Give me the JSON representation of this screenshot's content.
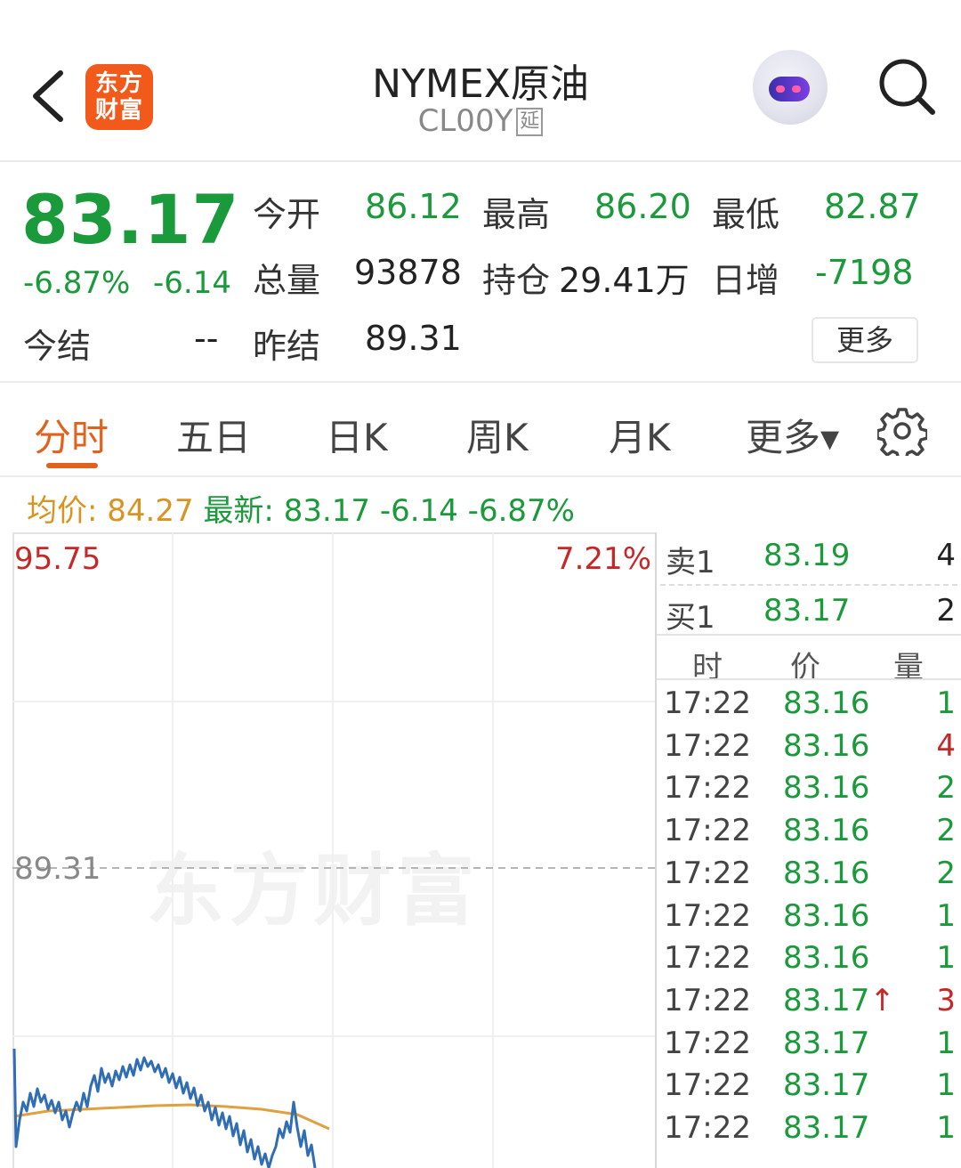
{
  "header": {
    "logo_line1": "东方",
    "logo_line2": "财富",
    "title": "NYMEX原油",
    "code": "CL00Y",
    "delay_tag": "延"
  },
  "quote": {
    "price": "83.17",
    "change_pct": "-6.87%",
    "change_abs": "-6.14",
    "open_label": "今开",
    "open": "86.12",
    "high_label": "最高",
    "high": "86.20",
    "low_label": "最低",
    "low": "82.87",
    "volume_label": "总量",
    "volume": "93878",
    "oi_label": "持仓",
    "oi": "29.41万",
    "daily_inc_label": "日增",
    "daily_inc": "-7198",
    "settle_label": "今结",
    "settle": "--",
    "prev_settle_label": "昨结",
    "prev_settle": "89.31",
    "more_label": "更多"
  },
  "tabs": [
    "分时",
    "五日",
    "日K",
    "周K",
    "月K",
    "更多▾"
  ],
  "info": {
    "avg_label": "均价:",
    "avg": "84.27",
    "latest_label": "最新:",
    "latest": "83.17",
    "latest_chg": "-6.14",
    "latest_pct": "-6.87%"
  },
  "chart": {
    "top_price": "95.75",
    "top_pct": "7.21%",
    "ref_price": "89.31",
    "watermark": "东方财富"
  },
  "orderbook": {
    "sell_label": "卖1",
    "sell_price": "83.19",
    "sell_vol": "4",
    "buy_label": "买1",
    "buy_price": "83.17",
    "buy_vol": "2",
    "col_time": "时",
    "col_price": "价",
    "col_vol": "量"
  },
  "ticks": [
    {
      "time": "17:22",
      "price": "83.16",
      "vol": "1",
      "vol_color": "green",
      "up": false
    },
    {
      "time": "17:22",
      "price": "83.16",
      "vol": "4",
      "vol_color": "red",
      "up": false
    },
    {
      "time": "17:22",
      "price": "83.16",
      "vol": "2",
      "vol_color": "green",
      "up": false
    },
    {
      "time": "17:22",
      "price": "83.16",
      "vol": "2",
      "vol_color": "green",
      "up": false
    },
    {
      "time": "17:22",
      "price": "83.16",
      "vol": "2",
      "vol_color": "green",
      "up": false
    },
    {
      "time": "17:22",
      "price": "83.16",
      "vol": "1",
      "vol_color": "green",
      "up": false
    },
    {
      "time": "17:22",
      "price": "83.16",
      "vol": "1",
      "vol_color": "green",
      "up": false
    },
    {
      "time": "17:22",
      "price": "83.17",
      "vol": "3",
      "vol_color": "red",
      "up": true
    },
    {
      "time": "17:22",
      "price": "83.17",
      "vol": "1",
      "vol_color": "green",
      "up": false
    },
    {
      "time": "17:22",
      "price": "83.17",
      "vol": "1",
      "vol_color": "green",
      "up": false
    },
    {
      "time": "17:22",
      "price": "83.17",
      "vol": "1",
      "vol_color": "green",
      "up": false
    }
  ],
  "colors": {
    "down": "#1a9a3a",
    "up": "#c62828",
    "accent": "#e2611c",
    "avg_line": "#e0a040",
    "price_line": "#2f6db5"
  },
  "icons": {
    "back": "chevron-left-icon",
    "search": "search-icon",
    "settings": "gear-icon",
    "assistant": "robot-avatar-icon"
  }
}
